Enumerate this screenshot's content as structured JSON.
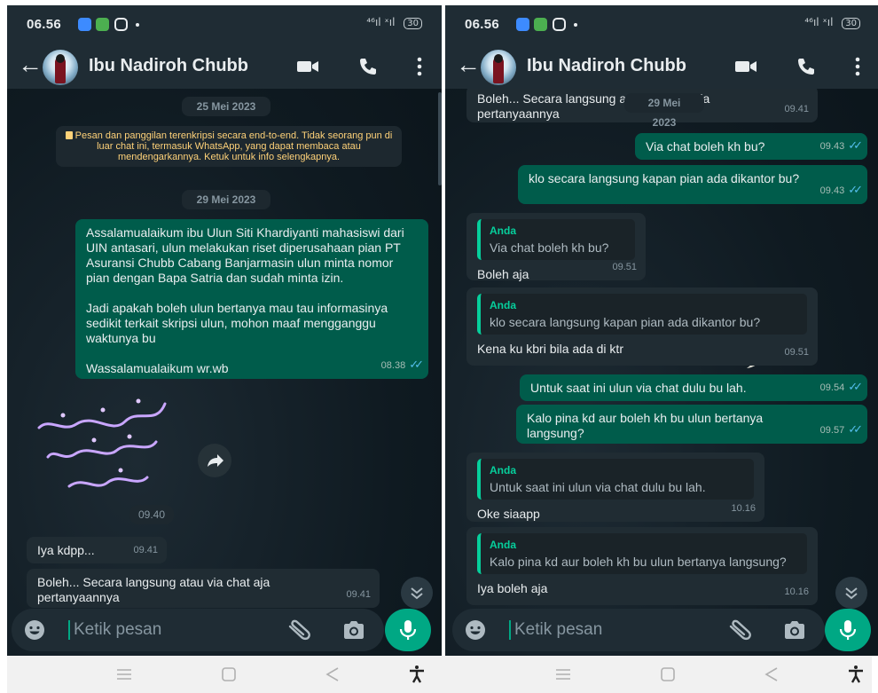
{
  "colors": {
    "chat_bg": "#0b141a",
    "header_bg": "#1f2c34",
    "outgoing_bubble": "#005c4b",
    "incoming_bubble": "#202c33",
    "accent": "#00a884",
    "read_ticks": "#53bdeb",
    "encryption_text": "#ffd279"
  },
  "status_bar": {
    "time": "06.56",
    "signal": "⁴⁶ıl ˣıl",
    "battery": "30"
  },
  "header": {
    "contact_name": "Ibu Nadiroh Chubb"
  },
  "composer": {
    "placeholder": "Ketik pesan"
  },
  "left": {
    "date_1": "25 Mei 2023",
    "encryption_notice": "Pesan dan panggilan terenkripsi secara end-to-end. Tidak seorang pun di luar chat ini, termasuk WhatsApp, yang dapat membaca atau mendengarkannya. Ketuk untuk info selengkapnya.",
    "date_2": "29 Mei 2023",
    "messages": [
      {
        "text": "Assalamualaikum ibu Ulun Siti Khardiyanti mahasiswi dari UIN antasari, ulun melakukan riset diperusahaan pian PT Asuransi Chubb Cabang Banjarmasin ulun minta nomor pian dengan Bapa Satria dan sudah minta izin.\n\nJadi apakah boleh ulun bertanya mau tau informasinya sedikit terkait skripsi ulun, mohon maaf mengganggu waktunya bu\n\nWassalamualaikum wr.wb",
        "time": "08.38"
      },
      {
        "text": "Iya kdpp...",
        "time": "09.41"
      },
      {
        "text": "Boleh... Secara langsung atau via chat aja pertanyaannya",
        "time": "09.41"
      }
    ],
    "sticker": {
      "alt": "Wa'alaikumussalam warahmatullah wabarakatuh",
      "time": "09.40"
    }
  },
  "right": {
    "date_chip": "29 Mei 2023",
    "messages": [
      {
        "text": "Boleh... Secara langsung atau via chat aja pertanyaannya",
        "time": "09.41"
      },
      {
        "text": "Via chat boleh kh bu?",
        "time": "09.43"
      },
      {
        "text": "klo secara langsung kapan pian ada dikantor bu?",
        "time": "09.43"
      },
      {
        "quote_author": "Anda",
        "quote_text": "Via chat boleh kh bu?",
        "text": "Boleh aja",
        "time": "09.51"
      },
      {
        "quote_author": "Anda",
        "quote_text": "klo secara langsung kapan pian ada dikantor bu?",
        "text": "Kena ku kbri bila ada di ktr",
        "time": "09.51"
      },
      {
        "text": "Untuk saat ini ulun via chat dulu bu lah.",
        "time": "09.54"
      },
      {
        "text": "Kalo pina kd aur boleh kh bu ulun bertanya langsung?",
        "time": "09.57"
      },
      {
        "quote_author": "Anda",
        "quote_text": "Untuk saat ini ulun via chat dulu bu lah.",
        "text": "Oke siaapp",
        "time": "10.16"
      },
      {
        "quote_author": "Anda",
        "quote_text": "Kalo pina kd aur boleh kh bu ulun bertanya langsung?",
        "text": "Iya boleh aja",
        "time": "10.16"
      }
    ]
  },
  "icons": {
    "back": "arrow-left-icon",
    "video": "video-camera-icon",
    "call": "phone-icon",
    "menu": "more-vertical-icon",
    "emoji": "emoji-icon",
    "attach": "paperclip-icon",
    "camera": "camera-icon",
    "mic": "microphone-icon",
    "scroll_down": "chevrons-down-icon",
    "nav_recent": "menu-lines-icon",
    "nav_home": "square-icon",
    "nav_back": "triangle-back-icon",
    "nav_accessibility": "accessibility-icon"
  }
}
